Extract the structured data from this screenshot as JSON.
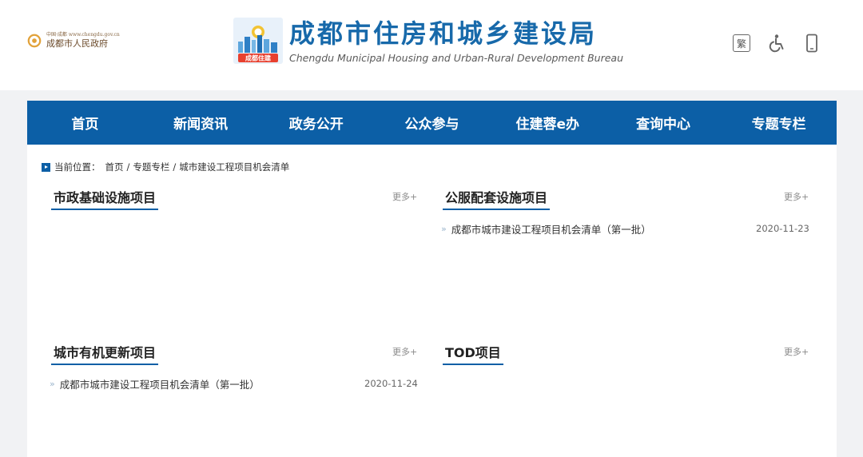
{
  "header": {
    "gov_small": "中国·成都 www.chengdu.gov.cn",
    "gov_name": "成都市人民政府",
    "bureau_badge": "成都住建",
    "bureau_name": "成都市住房和城乡建设局",
    "bureau_name_en": "Chengdu Municipal Housing and Urban-Rural Development Bureau",
    "tools": {
      "traditional": "繁",
      "accessibility_icon": "wheelchair-icon",
      "mobile_icon": "mobile-phone-icon"
    }
  },
  "nav": {
    "items": [
      {
        "label": "首页"
      },
      {
        "label": "新闻资讯"
      },
      {
        "label": "政务公开"
      },
      {
        "label": "公众参与"
      },
      {
        "label": "住建蓉e办"
      },
      {
        "label": "查询中心"
      },
      {
        "label": "专题专栏"
      }
    ]
  },
  "breadcrumb": {
    "label": "当前位置：",
    "items": [
      "首页",
      "专题专栏",
      "城市建设工程项目机会清单"
    ],
    "separator": "/"
  },
  "panels": [
    {
      "title": "市政基础设施项目",
      "more": "更多+",
      "items": []
    },
    {
      "title": "公服配套设施项目",
      "more": "更多+",
      "items": [
        {
          "text": "成都市城市建设工程项目机会清单（第一批）",
          "date": "2020-11-23"
        }
      ]
    },
    {
      "title": "城市有机更新项目",
      "more": "更多+",
      "items": [
        {
          "text": "成都市城市建设工程项目机会清单（第一批）",
          "date": "2020-11-24"
        }
      ]
    },
    {
      "title": "TOD项目",
      "more": "更多+",
      "items": []
    }
  ],
  "colors": {
    "brand_blue": "#0c5fa6",
    "title_blue": "#1769aa",
    "background": "#f1f2f4"
  }
}
